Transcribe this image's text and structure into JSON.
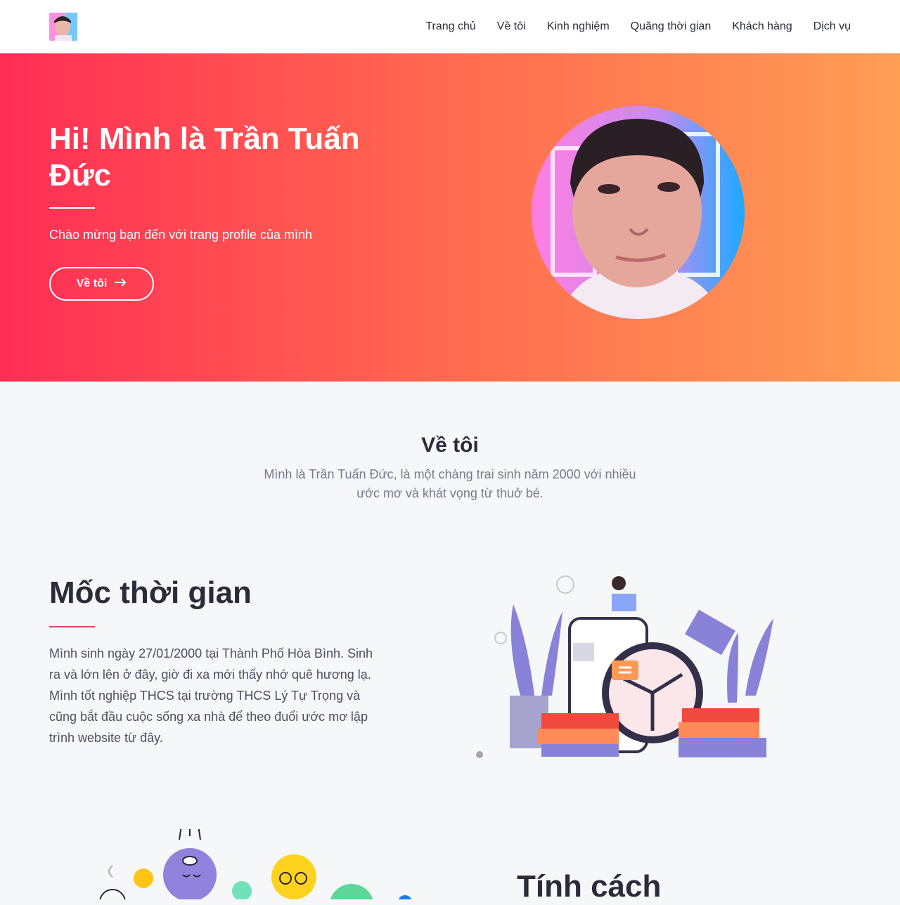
{
  "nav": {
    "items": [
      {
        "label": "Trang chủ"
      },
      {
        "label": "Về tôi"
      },
      {
        "label": "Kinh nghiệm"
      },
      {
        "label": "Quãng thời gian"
      },
      {
        "label": "Khách hàng"
      },
      {
        "label": "Dịch vụ"
      }
    ]
  },
  "hero": {
    "title": "Hi! Mình là Trần Tuấn Đức",
    "subtitle": "Chào mừng bạn đến với trang profile của mình",
    "button_label": "Về tôi",
    "button_icon": "arrow-right-icon"
  },
  "about": {
    "title": "Về tôi",
    "text": "Mình là Trần Tuấn Đức, là một chàng trai sinh năm 2000 với nhiều ước mơ và khát vọng từ thuở bé."
  },
  "timeline": {
    "title": "Mốc thời gian",
    "text": "Mình sinh ngày 27/01/2000 tại Thành Phố Hòa Bình. Sinh ra và lớn lên ở đây, giờ đi xa mới thấy nhớ quê hương lạ. Mình tốt nghiệp THCS tại trường THCS Lý Tự Trọng và cũng bắt đầu cuộc sống xa nhà để theo đuổi ước mơ lập trình website từ đây."
  },
  "personality": {
    "title": "Tính cách"
  },
  "colors": {
    "gradient_start": "#ff2d55",
    "gradient_end": "#ff9e55",
    "accent": "#e8415f"
  }
}
